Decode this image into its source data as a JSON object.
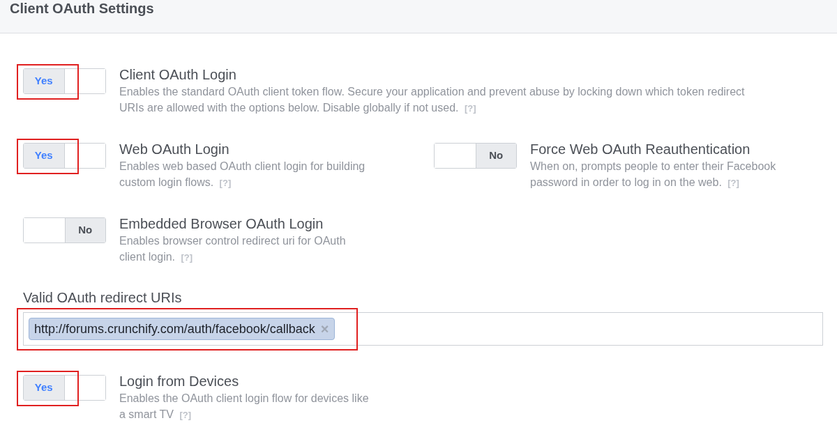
{
  "header": {
    "title": "Client OAuth Settings"
  },
  "sections": [
    {
      "kind": "toggles",
      "settings": [
        {
          "title": "Client OAuth Login",
          "description": "Enables the standard OAuth client token flow. Secure your application and prevent abuse by locking down which token redirect URIs are allowed with the options below. Disable globally if not used.",
          "help": "[?]",
          "on": true,
          "toggle_label": "Yes",
          "highlighted": true
        }
      ]
    },
    {
      "kind": "toggles",
      "settings": [
        {
          "title": "Web OAuth Login",
          "description": "Enables web based OAuth client login for building custom login flows.",
          "help": "[?]",
          "on": true,
          "toggle_label": "Yes",
          "highlighted": true
        },
        {
          "title": "Force Web OAuth Reauthentication",
          "description": "When on, prompts people to enter their Facebook password in order to log in on the web.",
          "help": "[?]",
          "on": false,
          "toggle_label": "No",
          "highlighted": false
        }
      ]
    },
    {
      "kind": "toggles",
      "settings": [
        {
          "title": "Embedded Browser OAuth Login",
          "description": "Enables browser control redirect uri for OAuth client login.",
          "help": "[?]",
          "on": false,
          "toggle_label": "No",
          "highlighted": false
        }
      ]
    },
    {
      "kind": "uri_field",
      "label": "Valid OAuth redirect URIs",
      "tags": [
        {
          "text": "http://forums.crunchify.com/auth/facebook/callback",
          "remove": "×"
        }
      ],
      "highlighted": true
    },
    {
      "kind": "toggles",
      "settings": [
        {
          "title": "Login from Devices",
          "description": "Enables the OAuth client login flow for devices like a smart TV",
          "help": "[?]",
          "on": true,
          "toggle_label": "Yes",
          "highlighted": true
        }
      ]
    }
  ]
}
